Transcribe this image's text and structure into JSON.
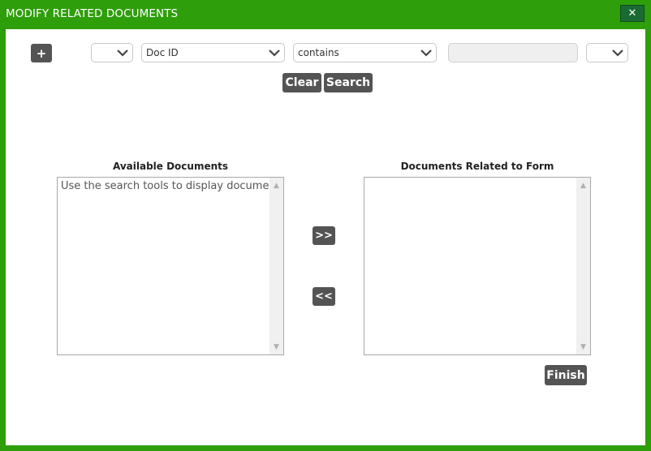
{
  "window": {
    "title": "MODIFY RELATED DOCUMENTS",
    "close_label": "✕"
  },
  "search": {
    "add_label": "+",
    "logic_select": {
      "value": ""
    },
    "field_select": {
      "value": "Doc ID"
    },
    "operator_select": {
      "value": "contains"
    },
    "value_input": {
      "value": "",
      "placeholder": ""
    },
    "extra_select": {
      "value": ""
    },
    "clear_label": "Clear",
    "search_label": "Search"
  },
  "available": {
    "title": "Available Documents",
    "placeholder": "Use the search tools to display documen"
  },
  "related": {
    "title": "Documents Related to Form",
    "items": []
  },
  "actions": {
    "add_label": ">>",
    "remove_label": "<<",
    "finish_label": "Finish"
  },
  "colors": {
    "accent": "#2e9e0a",
    "close_bg": "#1a6b33",
    "button_bg": "#545454"
  }
}
